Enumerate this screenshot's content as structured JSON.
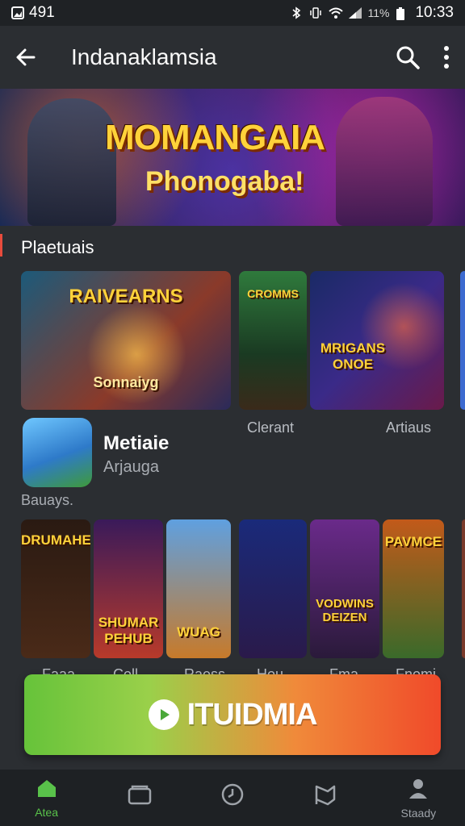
{
  "status_bar": {
    "left_text": "491",
    "battery_percent": "11%",
    "time": "10:33"
  },
  "app_bar": {
    "title": "Indanaklamsia",
    "back_icon": "arrow-left-icon",
    "search_icon": "search-icon",
    "menu_icon": "more-vert-icon"
  },
  "banner": {
    "headline": "MOMANGAIA",
    "subline": "Phonogaba!"
  },
  "section": {
    "title": "Plaetuais"
  },
  "featured_tiles": [
    {
      "label": "RAIVEARNS",
      "sub": "Sonnaiyg"
    },
    {
      "label": "CROMMS"
    },
    {
      "label": "MRIGANS ONOE"
    }
  ],
  "featured_captions": [
    "Clerant",
    "Artiaus"
  ],
  "app_row": {
    "name": "Metiaie",
    "sub": "Arjauga",
    "extra": "Bauays."
  },
  "small_tiles": [
    {
      "label": "DRUMAHE"
    },
    {
      "label": "SHUMAR PEHUB"
    },
    {
      "label": "WUAG"
    },
    {
      "label": ""
    },
    {
      "label": "VODWINS DEIZEN"
    },
    {
      "label": "PAVMCE"
    }
  ],
  "small_captions": [
    "Faaa",
    "Coll",
    "Raess",
    "Hou",
    "Fma",
    "Fnomi"
  ],
  "cta": {
    "label": "ITUIDMIA"
  },
  "bottom_nav": {
    "items": [
      {
        "label": "Atea",
        "icon": "home-icon",
        "active": true
      },
      {
        "label": "",
        "icon": "wallet-icon",
        "active": false
      },
      {
        "label": "",
        "icon": "clock-icon",
        "active": false
      },
      {
        "label": "",
        "icon": "flag-icon",
        "active": false
      },
      {
        "label": "Staady",
        "icon": "person-icon",
        "active": false
      }
    ]
  },
  "colors": {
    "background": "#2b2e32",
    "accent_green": "#59c24a",
    "cta_left": "#66c33a",
    "cta_right": "#f04a2a",
    "title_yellow": "#ffd23a"
  }
}
